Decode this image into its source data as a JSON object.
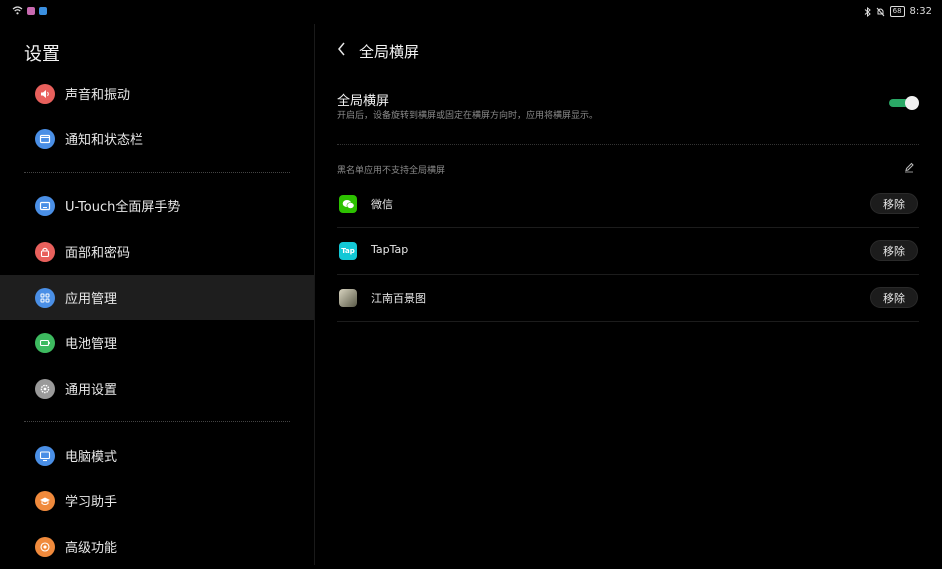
{
  "status_bar": {
    "time": "8:32",
    "battery": "68",
    "icons": [
      "wifi-icon",
      "app-notification-icon",
      "app-notification-icon",
      "bluetooth-icon",
      "silent-icon",
      "battery-icon"
    ]
  },
  "sidebar": {
    "title": "设置",
    "items": [
      {
        "label": "声音和振动",
        "icon": "speaker-icon",
        "color": "#e8605c"
      },
      {
        "label": "通知和状态栏",
        "icon": "notification-icon",
        "color": "#4a8fe6"
      },
      {
        "label": "U-Touch全面屏手势",
        "icon": "gesture-icon",
        "color": "#4a8fe6"
      },
      {
        "label": "面部和密码",
        "icon": "lock-icon",
        "color": "#e8605c"
      },
      {
        "label": "应用管理",
        "icon": "apps-icon",
        "color": "#4a8fe6",
        "active": true
      },
      {
        "label": "电池管理",
        "icon": "battery-icon",
        "color": "#3dba5f"
      },
      {
        "label": "通用设置",
        "icon": "gear-icon",
        "color": "#9a9a9a"
      },
      {
        "label": "电脑模式",
        "icon": "monitor-icon",
        "color": "#4a8fe6"
      },
      {
        "label": "学习助手",
        "icon": "graduation-cap-icon",
        "color": "#f08a3c"
      },
      {
        "label": "高级功能",
        "icon": "advanced-icon",
        "color": "#f08a3c"
      }
    ]
  },
  "detail": {
    "title": "全局横屏",
    "setting": {
      "title": "全局横屏",
      "description": "开启后，设备旋转到横屏或固定在横屏方向时，应用将横屏显示。",
      "enabled": true,
      "toggle_color": "#2aa866"
    },
    "blacklist_label": "黑名单应用不支持全局横屏",
    "apps": [
      {
        "name": "微信",
        "icon": "wechat-icon",
        "icon_text": "",
        "color": "#2dc100",
        "button": "移除"
      },
      {
        "name": "TapTap",
        "icon": "taptap-icon",
        "icon_text": "Tap",
        "color": "#13c8d6",
        "button": "移除"
      },
      {
        "name": "江南百景图",
        "icon": "game-icon",
        "icon_text": "",
        "color": "#8c8c7a",
        "button": "移除"
      }
    ]
  }
}
